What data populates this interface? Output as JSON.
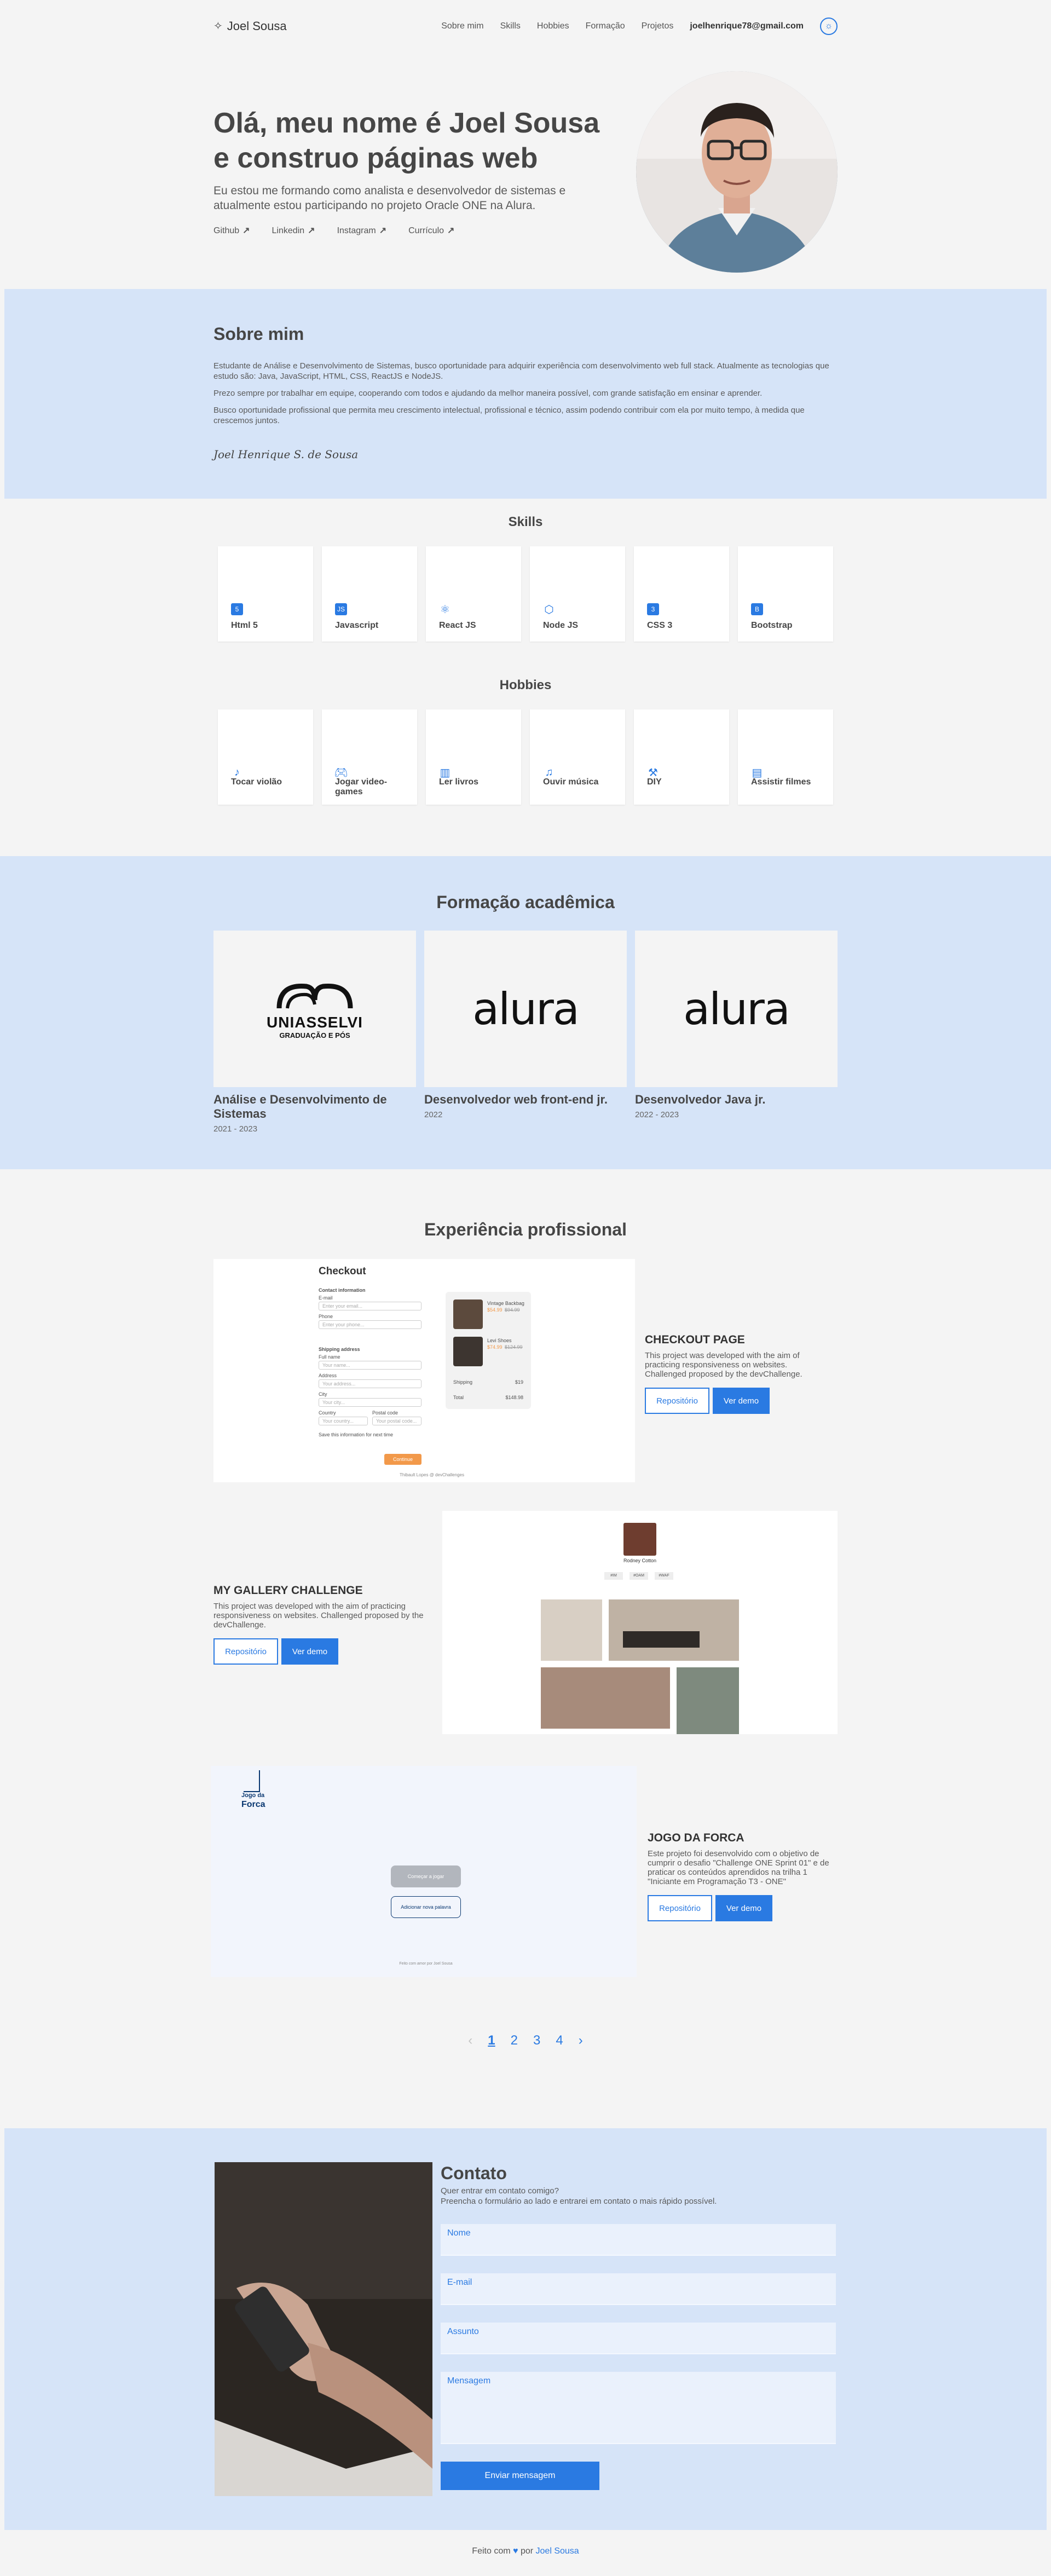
{
  "header": {
    "logo": "Joel Sousa",
    "nav": [
      "Sobre mim",
      "Skills",
      "Hobbies",
      "Formação",
      "Projetos"
    ],
    "email": "joelhenrique78@gmail.com"
  },
  "hero": {
    "title": "Olá, meu nome é Joel Sousa e construo páginas web",
    "subtitle": "Eu estou me formando como analista e desenvolvedor de sistemas e atualmente estou participando no projeto Oracle ONE na Alura.",
    "links": [
      "Github",
      "Linkedin",
      "Instagram",
      "Currículo"
    ]
  },
  "about": {
    "title": "Sobre mim",
    "paragraphs": [
      "Estudante de Análise e Desenvolvimento de Sistemas, busco oportunidade para adquirir experiência com desenvolvimento web full stack. Atualmente as tecnologias que estudo são: Java, JavaScript, HTML, CSS, ReactJS e NodeJS.",
      "Prezo sempre por trabalhar em equipe, cooperando com todos e ajudando da melhor maneira possível, com grande satisfação em ensinar e aprender.",
      "Busco oportunidade profissional que permita meu crescimento intelectual, profissional e técnico, assim podendo contribuir com ela por muito tempo, à medida que crescemos juntos."
    ],
    "signature": "Joel Henrique S. de Sousa"
  },
  "skills": {
    "title": "Skills",
    "items": [
      {
        "label": "Html 5",
        "icon": "html5-icon"
      },
      {
        "label": "Javascript",
        "icon": "javascript-icon"
      },
      {
        "label": "React JS",
        "icon": "react-icon"
      },
      {
        "label": "Node JS",
        "icon": "nodejs-icon"
      },
      {
        "label": "CSS 3",
        "icon": "css3-icon"
      },
      {
        "label": "Bootstrap",
        "icon": "bootstrap-icon"
      }
    ]
  },
  "hobbies": {
    "title": "Hobbies",
    "items": [
      {
        "label": "Tocar violão",
        "icon": "guitar-icon"
      },
      {
        "label": "Jogar video-games",
        "icon": "gamepad-icon"
      },
      {
        "label": "Ler livros",
        "icon": "book-icon"
      },
      {
        "label": "Ouvir música",
        "icon": "music-icon"
      },
      {
        "label": "DIY",
        "icon": "tools-icon"
      },
      {
        "label": "Assistir filmes",
        "icon": "popcorn-icon"
      }
    ]
  },
  "education": {
    "title": "Formação acadêmica",
    "items": [
      {
        "logo": "UNIASSELVI",
        "logo_sub": "GRADUAÇÃO E PÓS",
        "course": "Análise e Desenvolvimento de Sistemas",
        "years": "2021 - 2023"
      },
      {
        "logo": "alura",
        "course": "Desenvolvedor web front-end jr.",
        "years": "2022"
      },
      {
        "logo": "alura",
        "course": "Desenvolvedor Java jr.",
        "years": "2022 - 2023"
      }
    ]
  },
  "experience": {
    "title": "Experiência profissional",
    "repo_label": "Repositório",
    "demo_label": "Ver demo",
    "projects": [
      {
        "title": "CHECKOUT PAGE",
        "description": "This project was developed with the aim of practicing responsiveness on websites. Challenged proposed by the devChallenge."
      },
      {
        "title": "MY GALLERY CHALLENGE",
        "description": "This project was developed with the aim of practicing responsiveness on websites. Challenged proposed by the devChallenge."
      },
      {
        "title": "JOGO DA FORCA",
        "description": "Este projeto foi desenvolvido com o objetivo de cumprir o desafio \"Challenge ONE Sprint 01\" e de praticar os conteúdos aprendidos na trilha 1 \"Iniciante em Programação T3 - ONE\""
      }
    ],
    "checkout_mock": {
      "title": "Checkout",
      "contact": "Contact information",
      "email_label": "E-mail",
      "email_ph": "Enter your email...",
      "phone_label": "Phone",
      "phone_ph": "Enter your phone...",
      "shipping": "Shipping address",
      "name_label": "Full name",
      "name_ph": "Your name...",
      "address_label": "Address",
      "address_ph": "Your address...",
      "city_label": "City",
      "city_ph": "Your city...",
      "country_label": "Country",
      "country_ph": "Your country...",
      "postal_label": "Postal code",
      "postal_ph": "Your postal code...",
      "save": "Save this information for next time",
      "continue": "Continue",
      "item1": "Vintage Backbag",
      "item1_price": "$54.99",
      "item1_old": "$94.99",
      "item2": "Levi Shoes",
      "item2_price": "$74.99",
      "item2_old": "$124.99",
      "shipping_label": "Shipping",
      "shipping_val": "$19",
      "total_label": "Total",
      "total_val": "$148.98",
      "credit": "Thibault Lopes @ devChallenges"
    },
    "gallery_mock": {
      "name": "Rodney Cotton",
      "tags": [
        "#IM",
        "#OAM",
        "#WAF"
      ]
    },
    "forca_mock": {
      "logo_top": "Jogo da",
      "logo_bottom": "Forca",
      "start": "Começar a jogar",
      "add_word": "Adicionar nova palavra",
      "credit": "Feito com amor por Joel Sousa"
    }
  },
  "pagination": {
    "prev": "‹",
    "pages": [
      "1",
      "2",
      "3",
      "4"
    ],
    "next": "›"
  },
  "contact": {
    "title": "Contato",
    "desc_line1": "Quer entrar em contato comigo?",
    "desc_line2": "Preencha o formulário ao lado e entrarei em contato o mais rápido possível.",
    "fields": [
      "Nome",
      "E-mail",
      "Assunto",
      "Mensagem"
    ],
    "submit": "Enviar mensagem"
  },
  "footer": {
    "prefix": "Feito com",
    "heart": "♥",
    "mid": "por",
    "author": "Joel Sousa"
  },
  "colors": {
    "accent": "#2a7ae2",
    "section_bg": "#d6e4f8",
    "page_bg": "#f4f4f4",
    "text": "#464646"
  }
}
